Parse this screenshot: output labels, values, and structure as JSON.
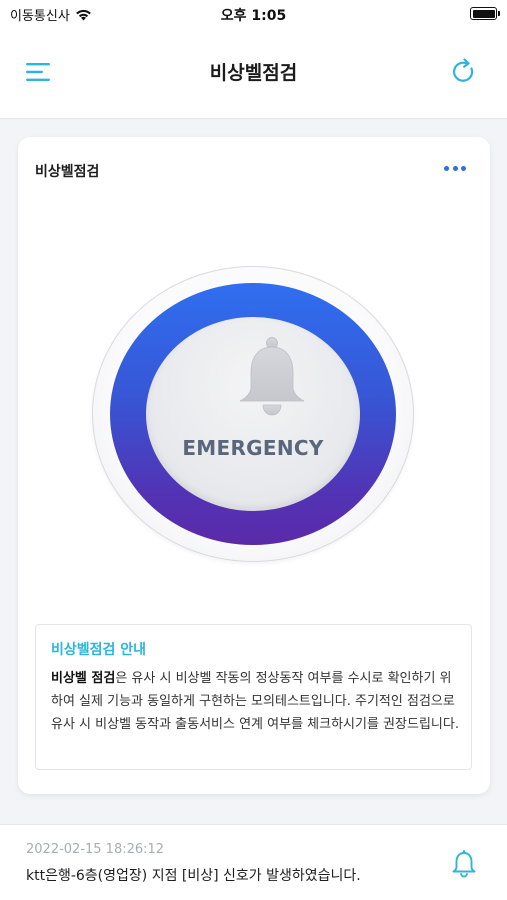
{
  "status_bar": {
    "carrier": "이동통신사",
    "time": "오후 1:05",
    "icons": [
      "wifi-icon",
      "battery-icon"
    ]
  },
  "header": {
    "title": "비상벨점검",
    "left_icon": "menu-icon",
    "right_icon": "refresh-icon"
  },
  "card": {
    "title": "비상벨점검",
    "more_icon": "more-dots-icon",
    "button": {
      "label": "EMERGENCY",
      "icon": "bell-icon"
    },
    "guide": {
      "title": "비상벨점검 안내",
      "bold_lead": "비상벨 점검",
      "body": "은 유사 시 비상벨 작동의 정상동작 여부를 수시로 확인하기 위하여 실제 기능과 동일하게 구현하는 모의테스트입니다. 주기적인 점검으로 유사 시 비상벨 동작과 출동서비스 연계 여부를 체크하시기를 권장드립니다."
    }
  },
  "notification": {
    "timestamp": "2022-02-15 18:26:12",
    "message": "ktt은행-6층(영업장) 지점 [비상] 신호가 발생하였습니다.",
    "icon": "bell-outline-icon"
  },
  "colors": {
    "accent": "#2cb5dd",
    "ring_top": "#2f6ff0",
    "ring_bottom": "#5b2aa8",
    "more_dots": "#2f6fd8"
  }
}
